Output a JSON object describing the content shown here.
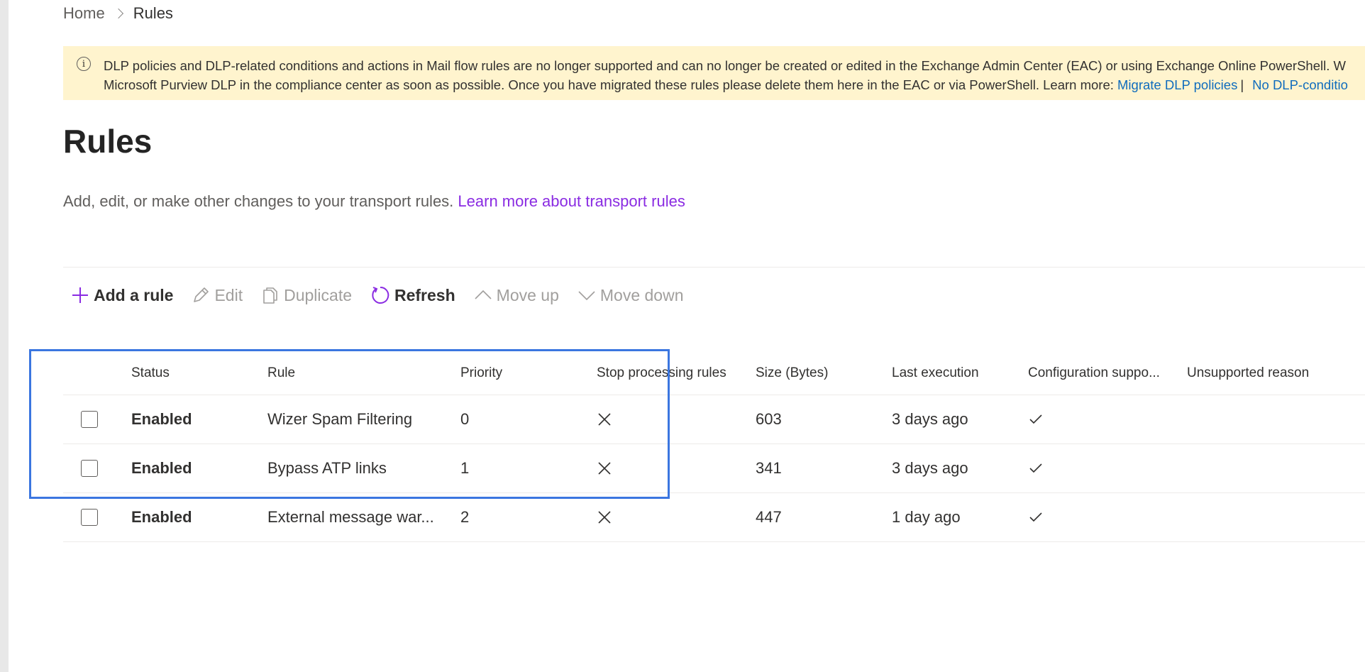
{
  "breadcrumb": {
    "home": "Home",
    "current": "Rules"
  },
  "banner": {
    "icon": "info-icon",
    "line1": "DLP policies and DLP-related conditions and actions in Mail flow rules are no longer supported and can no longer be created or edited in the Exchange Admin Center (EAC) or using Exchange Online PowerShell. W",
    "line2": "Microsoft Purview DLP in the compliance center as soon as possible. Once you have migrated these rules please delete them here in the EAC or via PowerShell. Learn more:",
    "link1": "Migrate DLP policies",
    "separator": "|",
    "link2": "No DLP-conditio"
  },
  "page": {
    "title": "Rules",
    "description": "Add, edit, or make other changes to your transport rules.",
    "learn_more": "Learn more about transport rules"
  },
  "toolbar": {
    "add": "Add a rule",
    "edit": "Edit",
    "duplicate": "Duplicate",
    "refresh": "Refresh",
    "move_up": "Move up",
    "move_down": "Move down"
  },
  "colors": {
    "accent": "#8a2be2",
    "link": "#0f6cbd",
    "banner_bg": "#fff4ce",
    "highlight": "#3b76e0"
  },
  "table": {
    "columns": [
      "Status",
      "Rule",
      "Priority",
      "Stop processing rules",
      "Size (Bytes)",
      "Last execution",
      "Configuration suppo...",
      "Unsupported reason"
    ],
    "rows": [
      {
        "status": "Enabled",
        "rule": "Wizer Spam Filtering",
        "priority": "0",
        "stop": "x-icon",
        "size": "603",
        "last": "3 days ago",
        "config": "check-icon",
        "reason": ""
      },
      {
        "status": "Enabled",
        "rule": "Bypass ATP links",
        "priority": "1",
        "stop": "x-icon",
        "size": "341",
        "last": "3 days ago",
        "config": "check-icon",
        "reason": ""
      },
      {
        "status": "Enabled",
        "rule": "External message war...",
        "priority": "2",
        "stop": "x-icon",
        "size": "447",
        "last": "1 day ago",
        "config": "check-icon",
        "reason": ""
      }
    ]
  }
}
